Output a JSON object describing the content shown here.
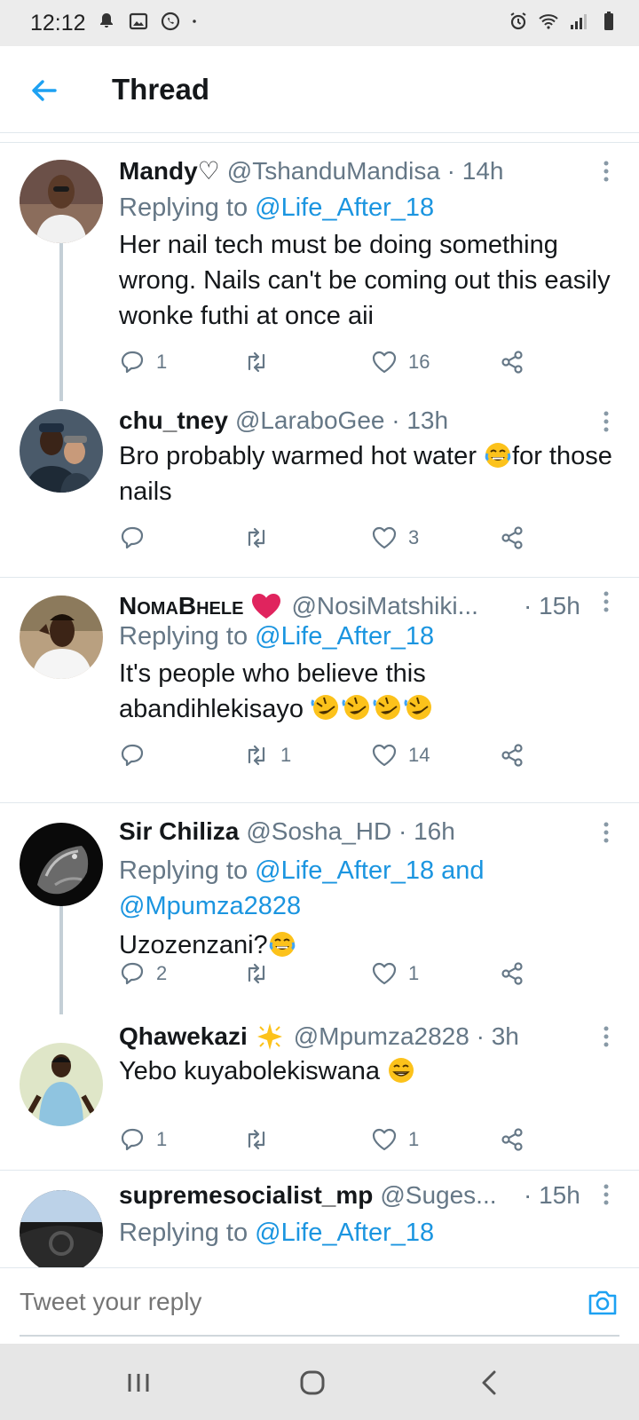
{
  "status_bar": {
    "time": "12:12"
  },
  "header": {
    "title": "Thread"
  },
  "colors": {
    "link": "#1b95e0",
    "heart_red": "#e0245e"
  },
  "tweets": [
    {
      "name": "Mandy♡",
      "handle_time": "@TshanduMandisa · 14h",
      "replying_prefix": "Replying to",
      "replying_to": "@Life_After_18",
      "text": "Her nail tech must be doing something wrong. Nails can't be coming out this easily wonke futhi at once aii",
      "replies": "1",
      "retweets": "",
      "likes": "16"
    },
    {
      "name": "chu_tney",
      "handle_time": "@LaraboGee · 13h",
      "text_before_emoji": "Bro probably warmed hot water ",
      "text_after_emoji": "for those nails",
      "replies": "",
      "retweets": "",
      "likes": "3"
    },
    {
      "name": "NomaBhele",
      "handle_time": "@NosiMatshiki...",
      "time": "· 15h",
      "replying_prefix": "Replying to",
      "replying_to": "@Life_After_18",
      "text_line1": "It's people who believe this",
      "text_line2": "abandihlekisayo ",
      "replies": "",
      "retweets": "1",
      "likes": "14"
    },
    {
      "name": "Sir Chiliza",
      "handle_time": "@Sosha_HD · 16h",
      "replying_prefix": "Replying to",
      "replying_to": "@Life_After_18 and",
      "replying_to_2": "@Mpumza2828",
      "text": "Uzozenzani?",
      "replies": "2",
      "retweets": "",
      "likes": "1"
    },
    {
      "name": "Qhawekazi",
      "handle_time": "@Mpumza2828 · 3h",
      "text": "Yebo kuyabolekiswana ",
      "replies": "1",
      "retweets": "",
      "likes": "1"
    },
    {
      "name": "supremesocialist_mp",
      "handle_time": "@Suges...",
      "time": "· 15h",
      "replying_prefix": "Replying to",
      "replying_to": "@Life_After_18"
    }
  ],
  "reply_box": {
    "placeholder": "Tweet your reply"
  }
}
